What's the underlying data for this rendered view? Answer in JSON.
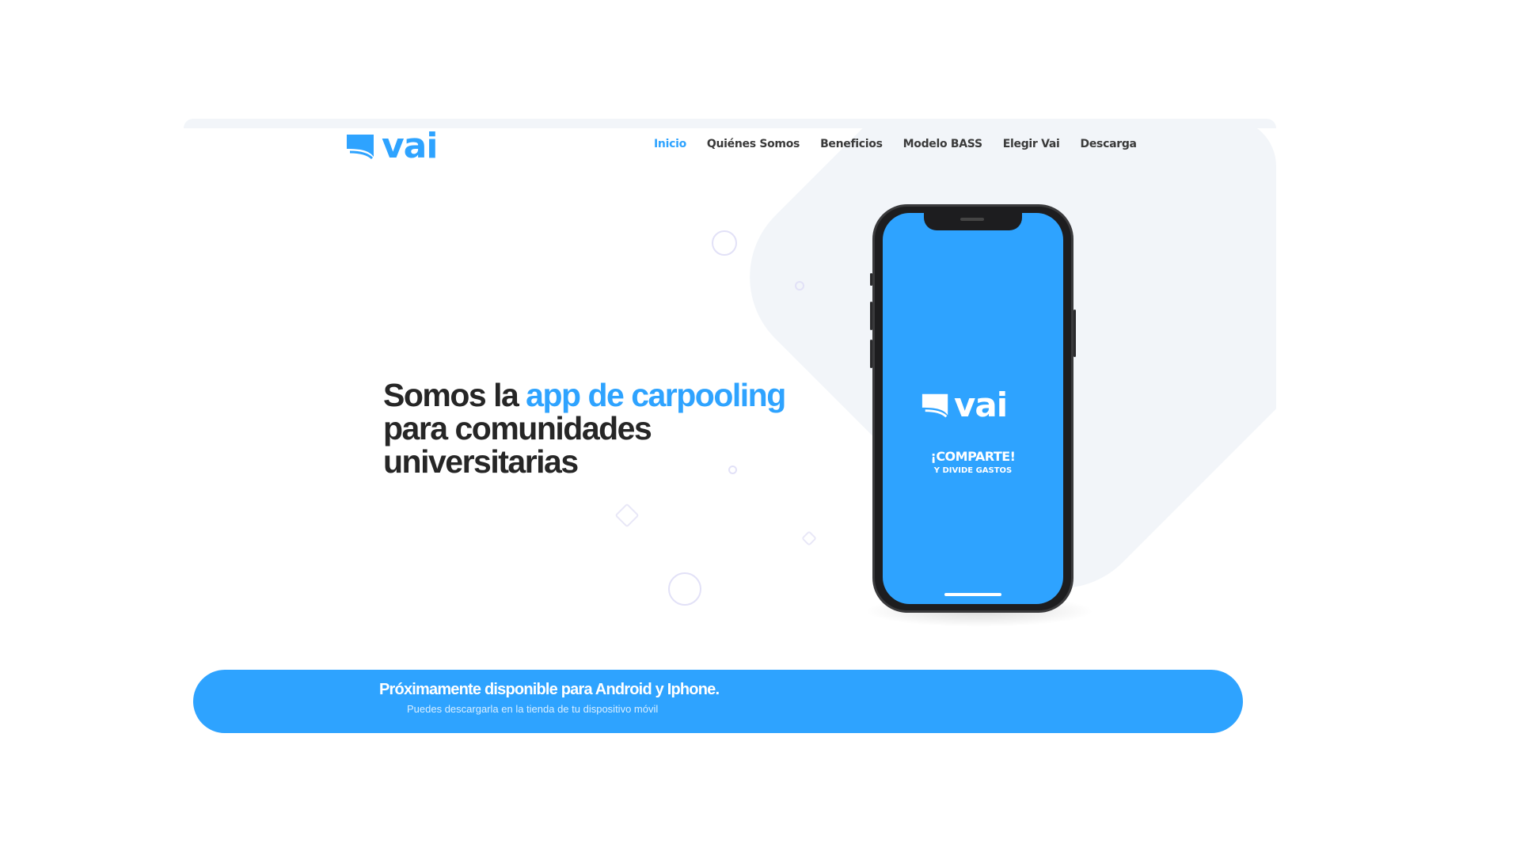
{
  "brand": {
    "name": "vai",
    "accent_color": "#2ea3ff",
    "logo_icon": "flag-logo-icon"
  },
  "nav": {
    "items": [
      {
        "label": "Inicio",
        "active": true
      },
      {
        "label": "Quiénes Somos",
        "active": false
      },
      {
        "label": "Beneficios",
        "active": false
      },
      {
        "label": "Modelo BASS",
        "active": false
      },
      {
        "label": "Elegir Vai",
        "active": false
      },
      {
        "label": "Descarga",
        "active": false
      }
    ]
  },
  "hero": {
    "prefix": "Somos la ",
    "highlight": "app de carpooling",
    "rest_line2": "para comunidades",
    "rest_line3": "universitarias"
  },
  "phone": {
    "app_name": "vai",
    "tagline": "¡COMPARTE!",
    "subtagline": "Y DIVIDE GASTOS"
  },
  "banner": {
    "title": "Próximamente disponible para Android y Iphone.",
    "subtitle": "Puedes descargarla en la tienda de tu dispositivo móvil"
  }
}
